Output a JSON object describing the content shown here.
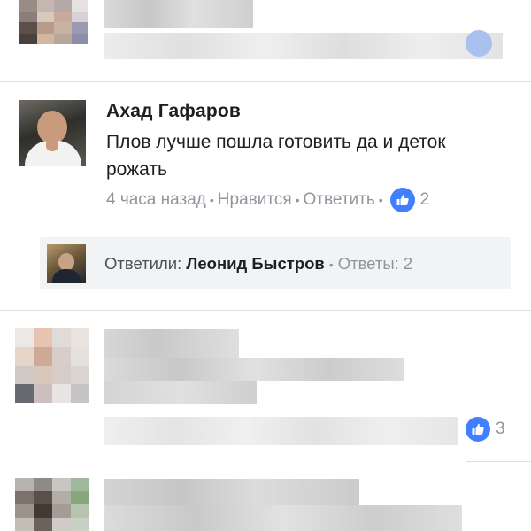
{
  "comments": [
    {
      "author": "Ахад Гафаров",
      "text": "Плов лучше пошла готовить да и деток рожать",
      "time": "4 часа назад",
      "like_action": "Нравится",
      "reply_action": "Ответить",
      "like_count": "2",
      "replies": {
        "prefix": "Ответили:",
        "name": "Леонид Быстров",
        "count_label": "Ответы: 2"
      }
    }
  ],
  "blurred_comment_like_count": "3",
  "icons": {
    "like": "thumbs-up-icon",
    "separator": "dot-separator"
  },
  "colors": {
    "accent": "#4080ff",
    "text": "#1c1e21",
    "muted": "#90949c",
    "reply_bg": "#f2f3f5"
  }
}
